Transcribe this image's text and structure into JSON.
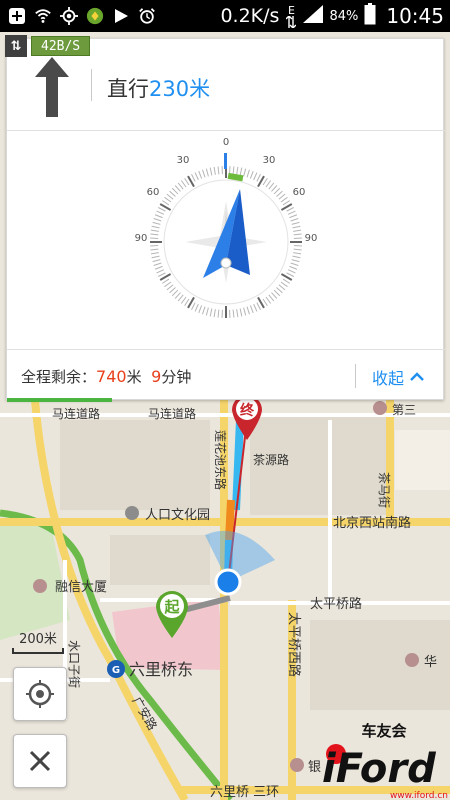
{
  "status_bar": {
    "speed": "0.2K/s",
    "network_type": "E",
    "battery": "84%",
    "time": "10:45"
  },
  "nav_card": {
    "net_rate": "42B/S",
    "instruction_action": "直行",
    "instruction_distance": "230米",
    "remaining_label": "全程剩余：",
    "remaining_distance": "740",
    "remaining_distance_unit": "米",
    "remaining_time": "9",
    "remaining_time_unit": "分钟",
    "collapse_label": "收起",
    "progress": 0.24
  },
  "compass": {
    "top_label": "0",
    "left_labels": [
      "30",
      "60",
      "90"
    ],
    "right_labels": [
      "30",
      "60",
      "90"
    ]
  },
  "map": {
    "labels": {
      "malian_road_1": "马连道路",
      "malian_road_2": "马连道路",
      "di_san": "第三",
      "road_v": "莲花池东路",
      "chayuan": "茶源路",
      "chama": "茶马街",
      "renkou_park": "人口文化园",
      "beijing_west_south": "北京西站南路",
      "rongxin": "融信大厦",
      "taiping_road": "太平桥路",
      "shuikouzi": "水口子街",
      "liuliqiao_east": "六里桥东",
      "taiping_west": "太平桥西路",
      "huaan": "华",
      "guang_an": "广安路",
      "liuliqiao_third": "六里桥  三环",
      "yin": "银",
      "end_marker": "终",
      "start_marker": "起"
    },
    "scale_label": "200米"
  },
  "colors": {
    "accent_blue": "#1f8ff0",
    "remaining_red": "#e8401b",
    "progress_green": "#4ab640",
    "route_red": "#c8262c",
    "major_road": "#f5d56a",
    "ring_road_green": "#6cbb4a"
  },
  "watermark": {
    "text_top": "车友会",
    "brand": "iFord",
    "url": "www.iford.cn"
  }
}
